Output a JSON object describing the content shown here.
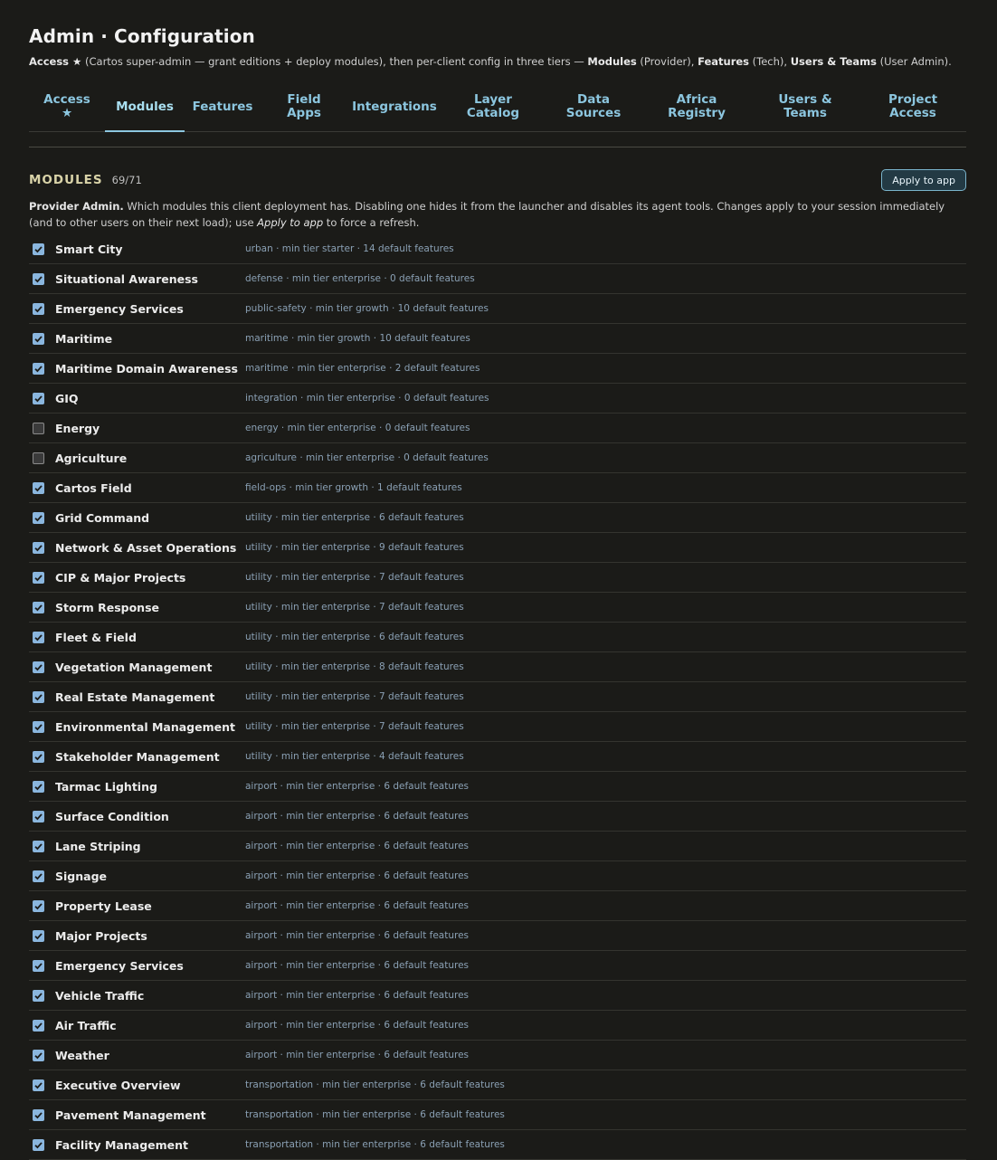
{
  "header": {
    "title": "Admin · Configuration",
    "subtitle": {
      "access": "Access ★",
      "part1": " (Cartos super-admin — grant editions + deploy modules), then per-client config in three tiers — ",
      "modules": "Modules",
      "part2": " (Provider), ",
      "features": "Features",
      "part3": " (Tech), ",
      "users": "Users & Teams",
      "part4": " (User Admin)."
    }
  },
  "tabs": [
    {
      "line1": "Access",
      "line2": "★"
    },
    {
      "line1": "Modules",
      "line2": ""
    },
    {
      "line1": "Features",
      "line2": ""
    },
    {
      "line1": "Field",
      "line2": "Apps"
    },
    {
      "line1": "Integrations",
      "line2": ""
    },
    {
      "line1": "Layer",
      "line2": "Catalog"
    },
    {
      "line1": "Data",
      "line2": "Sources"
    },
    {
      "line1": "Africa",
      "line2": "Registry"
    },
    {
      "line1": "Users &",
      "line2": "Teams"
    },
    {
      "line1": "Project",
      "line2": "Access"
    }
  ],
  "section": {
    "title": "MODULES",
    "count": "69/71",
    "apply_label": "Apply to app",
    "desc": {
      "bold": "Provider Admin.",
      "part1": " Which modules this client deployment has. Disabling one hides it from the launcher and disables its agent tools. Changes apply to your session immediately (and to other users on their next load); use ",
      "italic": "Apply to app",
      "part2": " to force a refresh."
    }
  },
  "modules": [
    {
      "name": "Smart City",
      "meta": "urban · min tier starter · 14 default features",
      "checked": true
    },
    {
      "name": "Situational Awareness",
      "meta": "defense · min tier enterprise · 0 default features",
      "checked": true
    },
    {
      "name": "Emergency Services",
      "meta": "public-safety · min tier growth · 10 default features",
      "checked": true
    },
    {
      "name": "Maritime",
      "meta": "maritime · min tier growth · 10 default features",
      "checked": true
    },
    {
      "name": "Maritime Domain Awareness",
      "meta": "maritime · min tier enterprise · 2 default features",
      "checked": true
    },
    {
      "name": "GIQ",
      "meta": "integration · min tier enterprise · 0 default features",
      "checked": true
    },
    {
      "name": "Energy",
      "meta": "energy · min tier enterprise · 0 default features",
      "checked": false
    },
    {
      "name": "Agriculture",
      "meta": "agriculture · min tier enterprise · 0 default features",
      "checked": false
    },
    {
      "name": "Cartos Field",
      "meta": "field-ops · min tier growth · 1 default features",
      "checked": true
    },
    {
      "name": "Grid Command",
      "meta": "utility · min tier enterprise · 6 default features",
      "checked": true
    },
    {
      "name": "Network & Asset Operations",
      "meta": "utility · min tier enterprise · 9 default features",
      "checked": true
    },
    {
      "name": "CIP & Major Projects",
      "meta": "utility · min tier enterprise · 7 default features",
      "checked": true
    },
    {
      "name": "Storm Response",
      "meta": "utility · min tier enterprise · 7 default features",
      "checked": true
    },
    {
      "name": "Fleet & Field",
      "meta": "utility · min tier enterprise · 6 default features",
      "checked": true
    },
    {
      "name": "Vegetation Management",
      "meta": "utility · min tier enterprise · 8 default features",
      "checked": true
    },
    {
      "name": "Real Estate Management",
      "meta": "utility · min tier enterprise · 7 default features",
      "checked": true
    },
    {
      "name": "Environmental Management",
      "meta": "utility · min tier enterprise · 7 default features",
      "checked": true
    },
    {
      "name": "Stakeholder Management",
      "meta": "utility · min tier enterprise · 4 default features",
      "checked": true
    },
    {
      "name": "Tarmac Lighting",
      "meta": "airport · min tier enterprise · 6 default features",
      "checked": true
    },
    {
      "name": "Surface Condition",
      "meta": "airport · min tier enterprise · 6 default features",
      "checked": true
    },
    {
      "name": "Lane Striping",
      "meta": "airport · min tier enterprise · 6 default features",
      "checked": true
    },
    {
      "name": "Signage",
      "meta": "airport · min tier enterprise · 6 default features",
      "checked": true
    },
    {
      "name": "Property Lease",
      "meta": "airport · min tier enterprise · 6 default features",
      "checked": true
    },
    {
      "name": "Major Projects",
      "meta": "airport · min tier enterprise · 6 default features",
      "checked": true
    },
    {
      "name": "Emergency Services",
      "meta": "airport · min tier enterprise · 6 default features",
      "checked": true
    },
    {
      "name": "Vehicle Traffic",
      "meta": "airport · min tier enterprise · 6 default features",
      "checked": true
    },
    {
      "name": "Air Traffic",
      "meta": "airport · min tier enterprise · 6 default features",
      "checked": true
    },
    {
      "name": "Weather",
      "meta": "airport · min tier enterprise · 6 default features",
      "checked": true
    },
    {
      "name": "Executive Overview",
      "meta": "transportation · min tier enterprise · 6 default features",
      "checked": true
    },
    {
      "name": "Pavement Management",
      "meta": "transportation · min tier enterprise · 6 default features",
      "checked": true
    },
    {
      "name": "Facility Management",
      "meta": "transportation · min tier enterprise · 6 default features",
      "checked": true
    }
  ],
  "active_tab": 1,
  "colors": {
    "accent": "#8cc6df",
    "checkbox_on": "#8ab6de"
  }
}
